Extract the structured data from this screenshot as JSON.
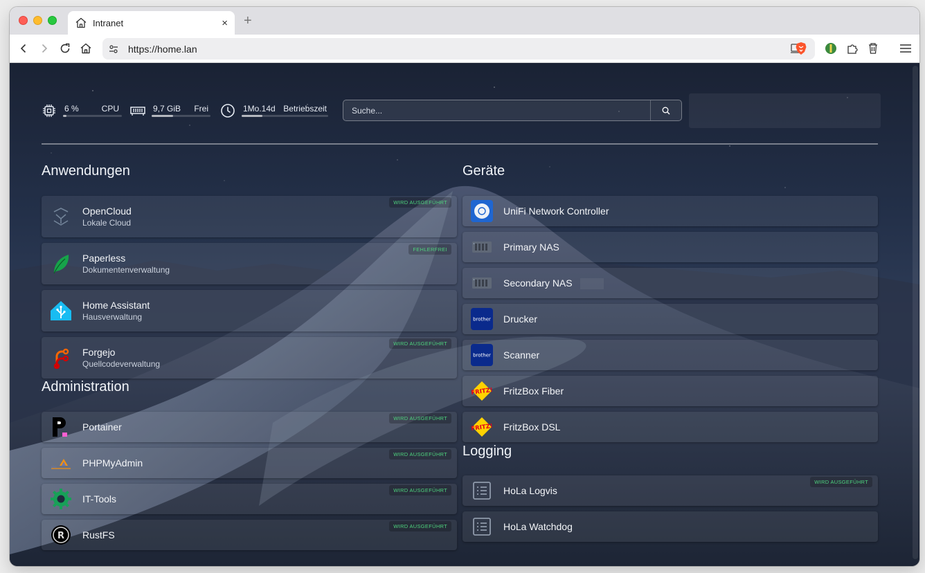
{
  "browser": {
    "tab_title": "Intranet",
    "tab_close": "×",
    "new_tab": "+",
    "url": "https://home.lan"
  },
  "widgets": {
    "cpu": {
      "value": "6 %",
      "label": "CPU",
      "level": 0.06
    },
    "memory": {
      "value": "9,7 GiB",
      "label": "Frei",
      "level": 0.37
    },
    "uptime": {
      "value": "1Mo.14d",
      "label": "Betriebszeit",
      "level": 0.24
    },
    "search_placeholder": "Suche..."
  },
  "sections": {
    "apps_title": "Anwendungen",
    "admin_title": "Administration",
    "devices_title": "Geräte",
    "logging_title": "Logging"
  },
  "apps": [
    {
      "name": "OpenCloud",
      "desc": "Lokale Cloud",
      "badge": "WIRD AUSGEFÜHRT",
      "icon": "opencloud-icon"
    },
    {
      "name": "Paperless",
      "desc": "Dokumentenverwaltung",
      "badge": "FEHLERFREI",
      "icon": "paperless-leaf-icon"
    },
    {
      "name": "Home Assistant",
      "desc": "Hausverwaltung",
      "badge": "",
      "icon": "home-assistant-icon"
    },
    {
      "name": "Forgejo",
      "desc": "Quellcodeverwaltung",
      "badge": "WIRD AUSGEFÜHRT",
      "icon": "forgejo-icon"
    }
  ],
  "admin": [
    {
      "name": "Portainer",
      "badge": "WIRD AUSGEFÜHRT",
      "icon": "portainer-icon"
    },
    {
      "name": "PHPMyAdmin",
      "badge": "WIRD AUSGEFÜHRT",
      "icon": "phpmyadmin-icon"
    },
    {
      "name": "IT-Tools",
      "badge": "WIRD AUSGEFÜHRT",
      "icon": "it-tools-gear-icon"
    },
    {
      "name": "RustFS",
      "badge": "WIRD AUSGEFÜHRT",
      "icon": "rust-gear-icon"
    }
  ],
  "devices": [
    {
      "name": "UniFi Network Controller",
      "icon": "unifi-icon"
    },
    {
      "name": "Primary NAS",
      "icon": "nas-icon"
    },
    {
      "name": "Secondary NAS",
      "icon": "nas-icon"
    },
    {
      "name": "Drucker",
      "icon": "brother-icon",
      "icon_text": "brother"
    },
    {
      "name": "Scanner",
      "icon": "brother-icon",
      "icon_text": "brother"
    },
    {
      "name": "FritzBox Fiber",
      "icon": "fritz-icon",
      "icon_text": "FRITZ!"
    },
    {
      "name": "FritzBox DSL",
      "icon": "fritz-icon",
      "icon_text": "FRITZ!"
    }
  ],
  "logging": [
    {
      "name": "HoLa Logvis",
      "badge": "WIRD AUSGEFÜHRT",
      "icon": "list-icon"
    },
    {
      "name": "HoLa Watchdog",
      "badge": "",
      "icon": "list-icon"
    }
  ],
  "colors": {
    "badge_green": "#4ed47e",
    "traffic_red": "#fe5f57",
    "traffic_yellow": "#febc2e",
    "traffic_green": "#28c840"
  }
}
